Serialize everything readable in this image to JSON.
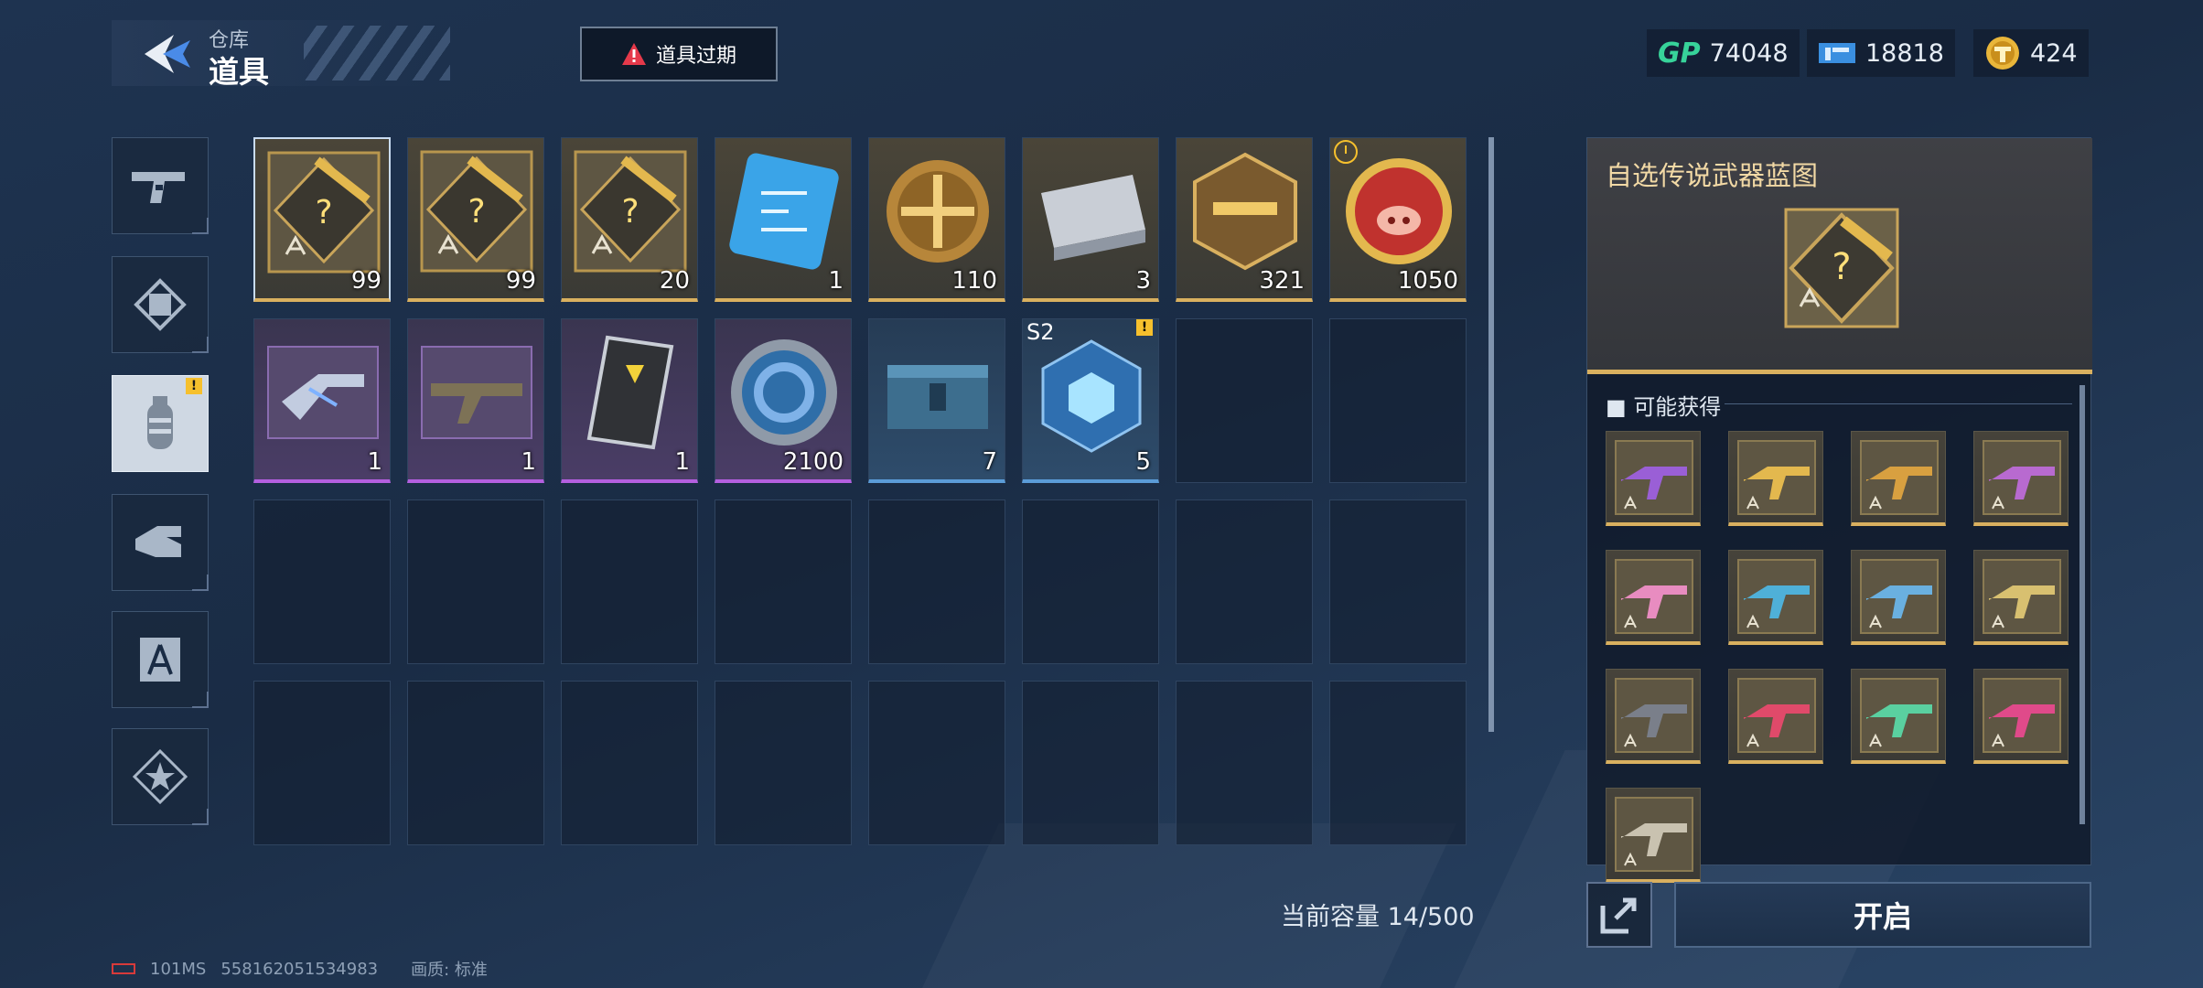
{
  "header": {
    "subtitle": "仓库",
    "title": "道具",
    "expire_button": "道具过期"
  },
  "currencies": [
    {
      "name": "GP",
      "value": "74048",
      "icon": "gp-icon"
    },
    {
      "name": "ticket",
      "value": "18818",
      "icon": "ticket-icon"
    },
    {
      "name": "coin",
      "value": "424",
      "icon": "coin-icon"
    }
  ],
  "sidebar_tabs": [
    "pistol-tab",
    "frame-tab",
    "grenade-tab",
    "hand-tab",
    "blueprint-tab",
    "star-tab"
  ],
  "items": [
    {
      "name": "legendary-weapon-blueprint",
      "count": "99",
      "rarity": "gold"
    },
    {
      "name": "legendary-weapon-blueprint",
      "count": "99",
      "rarity": "gold"
    },
    {
      "name": "legendary-weapon-blueprint",
      "count": "20",
      "rarity": "gold"
    },
    {
      "name": "chip-card",
      "count": "1",
      "rarity": "gold"
    },
    {
      "name": "gold-medal-coin",
      "count": "110",
      "rarity": "gold"
    },
    {
      "name": "silver-case",
      "count": "3",
      "rarity": "gold"
    },
    {
      "name": "gold-rifle-badge",
      "count": "321",
      "rarity": "gold"
    },
    {
      "name": "pig-coin",
      "count": "1050",
      "rarity": "gold"
    },
    {
      "name": "purple-smg",
      "count": "1",
      "rarity": "purple"
    },
    {
      "name": "camo-rifle",
      "count": "1",
      "rarity": "purple"
    },
    {
      "name": "dog-tag-card",
      "count": "1",
      "rarity": "purple"
    },
    {
      "name": "blue-ring-token",
      "count": "2100",
      "rarity": "purple"
    },
    {
      "name": "supply-crate",
      "count": "7",
      "rarity": "blue"
    },
    {
      "name": "s2-cube",
      "count": "5",
      "rarity": "blue",
      "label": "S2"
    }
  ],
  "capacity_text": "当前容量 14/500",
  "panel": {
    "title": "自选传说武器蓝图",
    "section_title": "可能获得",
    "reward_count": 13
  },
  "open_button": "开启",
  "footer": {
    "ping": "101MS",
    "uid": "558162051534983",
    "quality": "画质: 标准"
  },
  "colors": {
    "gold": "#d9b05f",
    "purple": "#b45fe0",
    "blue": "#5b9cd8",
    "gp": "#37d39a",
    "warning": "#f6c02d"
  }
}
